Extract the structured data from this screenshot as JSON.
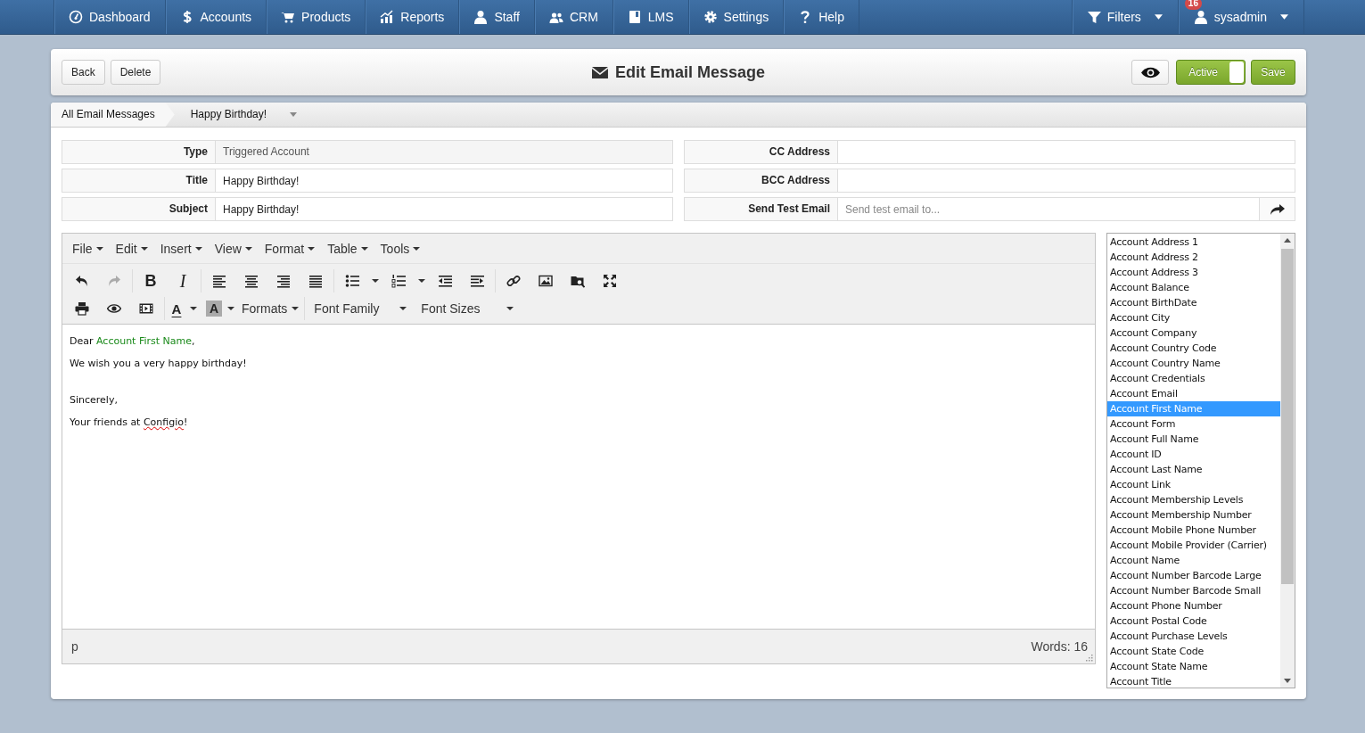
{
  "nav": {
    "items": [
      {
        "kind": "dashboard",
        "label": "Dashboard"
      },
      {
        "kind": "accounts",
        "label": "Accounts"
      },
      {
        "kind": "products",
        "label": "Products"
      },
      {
        "kind": "reports",
        "label": "Reports"
      },
      {
        "kind": "staff",
        "label": "Staff"
      },
      {
        "kind": "crm",
        "label": "CRM"
      },
      {
        "kind": "lms",
        "label": "LMS"
      },
      {
        "kind": "settings",
        "label": "Settings"
      },
      {
        "kind": "help",
        "label": "Help"
      }
    ],
    "filters": {
      "label": "Filters"
    },
    "user": {
      "name": "sysadmin",
      "badge": "16"
    }
  },
  "header": {
    "buttons": [
      "Back",
      "Delete"
    ],
    "title": "Edit Email Message",
    "status_toggle": {
      "label": "Active",
      "on": true
    },
    "save": "Save"
  },
  "breadcrumb": [
    "All Email Messages",
    "Happy Birthday!"
  ],
  "fields_left": [
    {
      "label": "Type",
      "value": "Triggered Account",
      "kind": "readonly"
    },
    {
      "label": "Title",
      "value": "Happy Birthday!",
      "kind": "input"
    },
    {
      "label": "Subject",
      "value": "Happy Birthday!",
      "kind": "input"
    }
  ],
  "fields_right": [
    {
      "label": "CC Address",
      "kind": "input"
    },
    {
      "label": "BCC Address",
      "kind": "input"
    },
    {
      "label": "Send Test Email",
      "placeholder": "Send test email to...",
      "kind": "send"
    }
  ],
  "editor": {
    "menus": [
      "File",
      "Edit",
      "Insert",
      "View",
      "Format",
      "Table",
      "Tools"
    ],
    "toolbar_rows": [
      [
        {
          "kind": "undo",
          "disabled": false
        },
        {
          "kind": "redo",
          "disabled": true
        },
        {
          "kind": "sep"
        },
        {
          "kind": "bold",
          "glyph": "B"
        },
        {
          "kind": "italic",
          "glyph": "I"
        },
        {
          "kind": "sep"
        },
        {
          "kind": "align-left"
        },
        {
          "kind": "align-center"
        },
        {
          "kind": "align-right"
        },
        {
          "kind": "justify"
        },
        {
          "kind": "sep"
        },
        {
          "kind": "bullets",
          "split": true
        },
        {
          "kind": "numbers",
          "split": true
        },
        {
          "kind": "outdent"
        },
        {
          "kind": "indent"
        },
        {
          "kind": "sep"
        },
        {
          "kind": "link"
        },
        {
          "kind": "image"
        },
        {
          "kind": "browse"
        },
        {
          "kind": "fullscreen"
        }
      ],
      [
        {
          "kind": "print"
        },
        {
          "kind": "preview"
        },
        {
          "kind": "media"
        },
        {
          "kind": "sep"
        },
        {
          "kind": "text-color",
          "glyph": "A",
          "split": true
        },
        {
          "kind": "back-color",
          "glyph": "A",
          "split": true
        },
        {
          "kind": "menu",
          "label": "Formats"
        },
        {
          "kind": "sep"
        },
        {
          "kind": "list",
          "label": "Font Family"
        },
        {
          "kind": "list",
          "label": "Font Sizes"
        }
      ]
    ],
    "content": [
      {
        "parts": [
          {
            "kind": "text",
            "text": "Dear "
          },
          {
            "kind": "merge-field",
            "text": "Account First Name"
          },
          {
            "kind": "text",
            "text": ","
          }
        ]
      },
      {
        "parts": [
          {
            "kind": "text",
            "text": "We wish you a very happy birthday!"
          }
        ]
      },
      {
        "parts": [
          {
            "kind": "text",
            "text": "Sincerely,"
          }
        ]
      },
      {
        "parts": [
          {
            "kind": "text",
            "text": "Your friends at "
          },
          {
            "kind": "misspelled",
            "text": "Configio"
          },
          {
            "kind": "text",
            "text": "!"
          }
        ]
      }
    ],
    "path": "p",
    "word_count": "Words: 16"
  },
  "merge_fields": [
    {
      "label": "Account Address 1",
      "selected": false
    },
    {
      "label": "Account Address 2",
      "selected": false
    },
    {
      "label": "Account Address 3",
      "selected": false
    },
    {
      "label": "Account Balance",
      "selected": false
    },
    {
      "label": "Account BirthDate",
      "selected": false
    },
    {
      "label": "Account City",
      "selected": false
    },
    {
      "label": "Account Company",
      "selected": false
    },
    {
      "label": "Account Country Code",
      "selected": false
    },
    {
      "label": "Account Country Name",
      "selected": false
    },
    {
      "label": "Account Credentials",
      "selected": false
    },
    {
      "label": "Account Email",
      "selected": false
    },
    {
      "label": "Account First Name",
      "selected": true
    },
    {
      "label": "Account Form",
      "selected": false
    },
    {
      "label": "Account Full Name",
      "selected": false
    },
    {
      "label": "Account ID",
      "selected": false
    },
    {
      "label": "Account Last Name",
      "selected": false
    },
    {
      "label": "Account Link",
      "selected": false
    },
    {
      "label": "Account Membership Levels",
      "selected": false
    },
    {
      "label": "Account Membership Number",
      "selected": false
    },
    {
      "label": "Account Mobile Phone Number",
      "selected": false
    },
    {
      "label": "Account Mobile Provider (Carrier)",
      "selected": false
    },
    {
      "label": "Account Name",
      "selected": false
    },
    {
      "label": "Account Number Barcode Large",
      "selected": false
    },
    {
      "label": "Account Number Barcode Small",
      "selected": false
    },
    {
      "label": "Account Phone Number",
      "selected": false
    },
    {
      "label": "Account Postal Code",
      "selected": false
    },
    {
      "label": "Account Purchase Levels",
      "selected": false
    },
    {
      "label": "Account State Code",
      "selected": false
    },
    {
      "label": "Account State Name",
      "selected": false
    },
    {
      "label": "Account Title",
      "selected": false
    }
  ]
}
